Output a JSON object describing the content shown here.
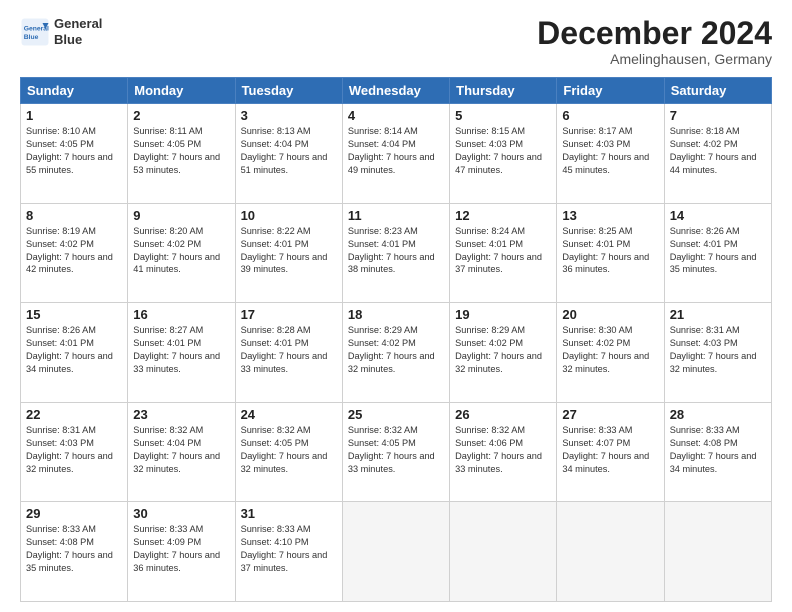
{
  "header": {
    "logo_line1": "General",
    "logo_line2": "Blue",
    "month": "December 2024",
    "location": "Amelinghausen, Germany"
  },
  "weekdays": [
    "Sunday",
    "Monday",
    "Tuesday",
    "Wednesday",
    "Thursday",
    "Friday",
    "Saturday"
  ],
  "weeks": [
    [
      {
        "day": 1,
        "sunrise": "8:10 AM",
        "sunset": "4:05 PM",
        "daylight": "7 hours and 55 minutes."
      },
      {
        "day": 2,
        "sunrise": "8:11 AM",
        "sunset": "4:05 PM",
        "daylight": "7 hours and 53 minutes."
      },
      {
        "day": 3,
        "sunrise": "8:13 AM",
        "sunset": "4:04 PM",
        "daylight": "7 hours and 51 minutes."
      },
      {
        "day": 4,
        "sunrise": "8:14 AM",
        "sunset": "4:04 PM",
        "daylight": "7 hours and 49 minutes."
      },
      {
        "day": 5,
        "sunrise": "8:15 AM",
        "sunset": "4:03 PM",
        "daylight": "7 hours and 47 minutes."
      },
      {
        "day": 6,
        "sunrise": "8:17 AM",
        "sunset": "4:03 PM",
        "daylight": "7 hours and 45 minutes."
      },
      {
        "day": 7,
        "sunrise": "8:18 AM",
        "sunset": "4:02 PM",
        "daylight": "7 hours and 44 minutes."
      }
    ],
    [
      {
        "day": 8,
        "sunrise": "8:19 AM",
        "sunset": "4:02 PM",
        "daylight": "7 hours and 42 minutes."
      },
      {
        "day": 9,
        "sunrise": "8:20 AM",
        "sunset": "4:02 PM",
        "daylight": "7 hours and 41 minutes."
      },
      {
        "day": 10,
        "sunrise": "8:22 AM",
        "sunset": "4:01 PM",
        "daylight": "7 hours and 39 minutes."
      },
      {
        "day": 11,
        "sunrise": "8:23 AM",
        "sunset": "4:01 PM",
        "daylight": "7 hours and 38 minutes."
      },
      {
        "day": 12,
        "sunrise": "8:24 AM",
        "sunset": "4:01 PM",
        "daylight": "7 hours and 37 minutes."
      },
      {
        "day": 13,
        "sunrise": "8:25 AM",
        "sunset": "4:01 PM",
        "daylight": "7 hours and 36 minutes."
      },
      {
        "day": 14,
        "sunrise": "8:26 AM",
        "sunset": "4:01 PM",
        "daylight": "7 hours and 35 minutes."
      }
    ],
    [
      {
        "day": 15,
        "sunrise": "8:26 AM",
        "sunset": "4:01 PM",
        "daylight": "7 hours and 34 minutes."
      },
      {
        "day": 16,
        "sunrise": "8:27 AM",
        "sunset": "4:01 PM",
        "daylight": "7 hours and 33 minutes."
      },
      {
        "day": 17,
        "sunrise": "8:28 AM",
        "sunset": "4:01 PM",
        "daylight": "7 hours and 33 minutes."
      },
      {
        "day": 18,
        "sunrise": "8:29 AM",
        "sunset": "4:02 PM",
        "daylight": "7 hours and 32 minutes."
      },
      {
        "day": 19,
        "sunrise": "8:29 AM",
        "sunset": "4:02 PM",
        "daylight": "7 hours and 32 minutes."
      },
      {
        "day": 20,
        "sunrise": "8:30 AM",
        "sunset": "4:02 PM",
        "daylight": "7 hours and 32 minutes."
      },
      {
        "day": 21,
        "sunrise": "8:31 AM",
        "sunset": "4:03 PM",
        "daylight": "7 hours and 32 minutes."
      }
    ],
    [
      {
        "day": 22,
        "sunrise": "8:31 AM",
        "sunset": "4:03 PM",
        "daylight": "7 hours and 32 minutes."
      },
      {
        "day": 23,
        "sunrise": "8:32 AM",
        "sunset": "4:04 PM",
        "daylight": "7 hours and 32 minutes."
      },
      {
        "day": 24,
        "sunrise": "8:32 AM",
        "sunset": "4:05 PM",
        "daylight": "7 hours and 32 minutes."
      },
      {
        "day": 25,
        "sunrise": "8:32 AM",
        "sunset": "4:05 PM",
        "daylight": "7 hours and 33 minutes."
      },
      {
        "day": 26,
        "sunrise": "8:32 AM",
        "sunset": "4:06 PM",
        "daylight": "7 hours and 33 minutes."
      },
      {
        "day": 27,
        "sunrise": "8:33 AM",
        "sunset": "4:07 PM",
        "daylight": "7 hours and 34 minutes."
      },
      {
        "day": 28,
        "sunrise": "8:33 AM",
        "sunset": "4:08 PM",
        "daylight": "7 hours and 34 minutes."
      }
    ],
    [
      {
        "day": 29,
        "sunrise": "8:33 AM",
        "sunset": "4:08 PM",
        "daylight": "7 hours and 35 minutes."
      },
      {
        "day": 30,
        "sunrise": "8:33 AM",
        "sunset": "4:09 PM",
        "daylight": "7 hours and 36 minutes."
      },
      {
        "day": 31,
        "sunrise": "8:33 AM",
        "sunset": "4:10 PM",
        "daylight": "7 hours and 37 minutes."
      },
      null,
      null,
      null,
      null
    ]
  ]
}
